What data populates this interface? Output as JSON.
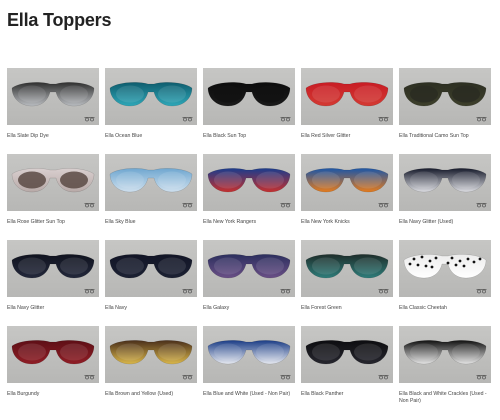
{
  "page": {
    "title": "Ella Toppers"
  },
  "products": [
    {
      "name": "Ella Slate Dip Dye",
      "top": "#2f2f2f",
      "bottom": "#b9bcc0",
      "lens": "none"
    },
    {
      "name": "Ella Ocean Blue",
      "top": "#0f5d6e",
      "bottom": "#2ea7b8",
      "lens": "none"
    },
    {
      "name": "Ella Black Sun Top",
      "top": "#0c0c0c",
      "bottom": "#1a1a1a",
      "lens": "dark"
    },
    {
      "name": "Ella Red Silver Glitter",
      "top": "#c81c24",
      "bottom": "#d33a33",
      "lens": "none"
    },
    {
      "name": "Ella Traditional Camo Sun Top",
      "top": "#2d2f22",
      "bottom": "#3d3f2b",
      "lens": "camo"
    },
    {
      "name": "Ella Rose Glitter Sun Top",
      "top": "#d9cfcf",
      "bottom": "#b8aaa8",
      "lens": "brown"
    },
    {
      "name": "Ella Sky Blue",
      "top": "#6fa7d0",
      "bottom": "#cfe0ee",
      "lens": "none"
    },
    {
      "name": "Ella New York Rangers",
      "top": "#1b3c8c",
      "bottom": "#c5302f",
      "lens": "none"
    },
    {
      "name": "Ella New York Knicks",
      "top": "#1c56a7",
      "bottom": "#e47b1d",
      "lens": "none"
    },
    {
      "name": "Ella Navy Glitter (Used)",
      "top": "#161a2b",
      "bottom": "#dcdde2",
      "lens": "none"
    },
    {
      "name": "Ella Navy Glitter",
      "top": "#10131f",
      "bottom": "#23283b",
      "lens": "none"
    },
    {
      "name": "Ella Navy",
      "top": "#121526",
      "bottom": "#1c2133",
      "lens": "none"
    },
    {
      "name": "Ella Galaxy",
      "top": "#2c2f5e",
      "bottom": "#6a4f86",
      "lens": "none"
    },
    {
      "name": "Ella Forest Green",
      "top": "#1e2e2b",
      "bottom": "#2e7d7a",
      "lens": "none"
    },
    {
      "name": "Ella Classic Cheetah",
      "top": "#ececec",
      "bottom": "#ffffff",
      "lens": "spots"
    },
    {
      "name": "Ella Burgundy",
      "top": "#5e0f16",
      "bottom": "#8f1d25",
      "lens": "none"
    },
    {
      "name": "Ella Brown and Yellow (Used)",
      "top": "#4a2f1b",
      "bottom": "#d9b64a",
      "lens": "none"
    },
    {
      "name": "Ella Blue and White (Used - Non Pair)",
      "top": "#1b3d86",
      "bottom": "#e6e9f0",
      "lens": "none"
    },
    {
      "name": "Ella Black Panther",
      "top": "#0d0d10",
      "bottom": "#26262e",
      "lens": "none"
    },
    {
      "name": "Ella Black and White Crackles (Used - Non Pair)",
      "top": "#111111",
      "bottom": "#e4e4e4",
      "lens": "none"
    }
  ]
}
